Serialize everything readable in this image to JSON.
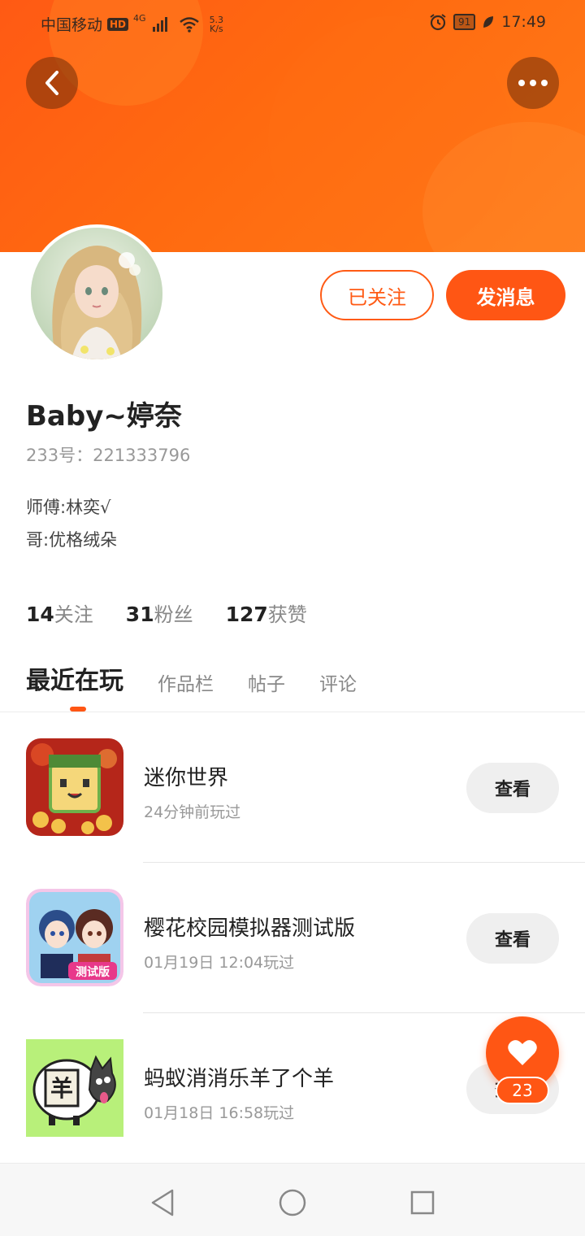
{
  "status_bar": {
    "carrier": "中国移动",
    "hd_badge": "HD",
    "network_type": "4G",
    "net_speed_value": "5.3",
    "net_speed_unit": "K/s",
    "battery": "91",
    "time": "17:49"
  },
  "header": {
    "back_icon": "chevron-left-icon",
    "more_icon": "more-dots-icon"
  },
  "profile": {
    "username": "Baby~婷奈",
    "id_text": "233号：221333796",
    "bio": [
      "师傅:林奕√",
      "哥:优格绒朵"
    ],
    "followed_label": "已关注",
    "message_label": "发消息",
    "stats": [
      {
        "num": "14",
        "label": "关注"
      },
      {
        "num": "31",
        "label": "粉丝"
      },
      {
        "num": "127",
        "label": "获赞"
      }
    ]
  },
  "tabs": [
    {
      "label": "最近在玩",
      "active": true
    },
    {
      "label": "作品栏",
      "active": false
    },
    {
      "label": "帖子",
      "active": false
    },
    {
      "label": "评论",
      "active": false
    }
  ],
  "games": [
    {
      "name": "迷你世界",
      "time": "24分钟前玩过",
      "button": "查看",
      "icon": "mini-world-icon"
    },
    {
      "name": "樱花校园模拟器测试版",
      "time": "01月19日 12:04玩过",
      "button": "查看",
      "icon": "sakura-school-icon",
      "badge": "测试版"
    },
    {
      "name": "蚂蚁消消乐羊了个羊",
      "time": "01月18日 16:58玩过",
      "button": "查看",
      "icon": "sheep-icon",
      "icon_text": "羊"
    }
  ],
  "like": {
    "count": "23",
    "icon": "heart-icon"
  },
  "colors": {
    "accent": "#ff5614",
    "banner": "#ff6a10"
  }
}
